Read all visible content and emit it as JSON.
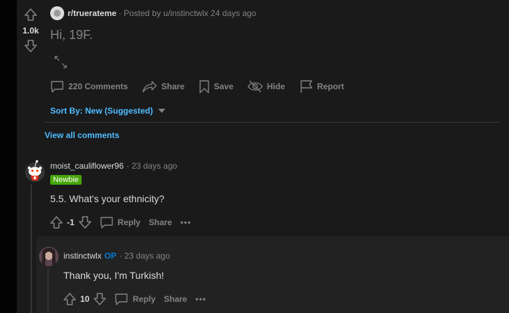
{
  "post": {
    "subreddit": "r/truerateme",
    "posted_by": "· Posted by u/instinctwlx 24 days ago",
    "score": "1.0k",
    "title": "Hi, 19F.",
    "actions": {
      "comments": "220 Comments",
      "share": "Share",
      "save": "Save",
      "hide": "Hide",
      "report": "Report"
    }
  },
  "sort": {
    "label": "Sort By: New (Suggested)"
  },
  "view_all_comments": "View all comments",
  "comments": [
    {
      "author": "moist_cauliflower96",
      "time": "· 23 days ago",
      "flair": "Newbie",
      "body": "5.5. What's your ethnicity?",
      "score": "-1",
      "reply": "Reply",
      "share": "Share",
      "more": "•••"
    },
    {
      "author": "instinctwlx",
      "op_badge": "OP",
      "time": "· 23 days ago",
      "body": "Thank you, I'm Turkish!",
      "score": "10",
      "reply": "Reply",
      "share": "Share",
      "more": "•••"
    }
  ],
  "colors": {
    "background": "#1a1a1b",
    "link_blue": "#4fbcff",
    "op_blue": "#0079d3",
    "flair_green": "#46a508",
    "muted_text": "#818384"
  }
}
